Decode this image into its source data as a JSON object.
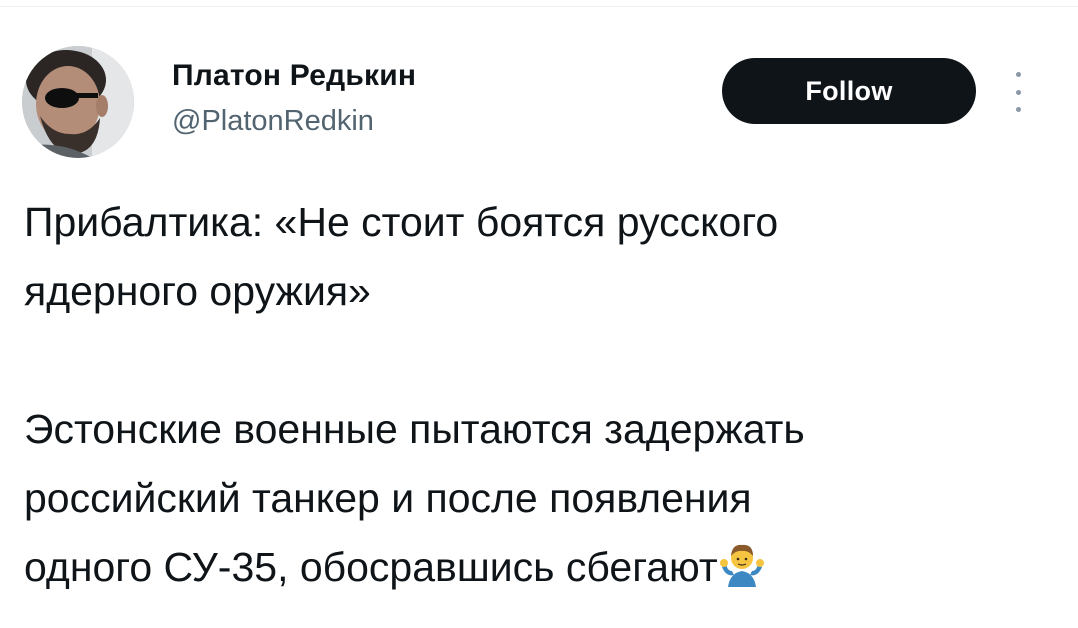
{
  "author": {
    "name": "Платон Редькин",
    "handle": "@PlatonRedkin",
    "avatar_icon": "user-avatar-photo"
  },
  "actions": {
    "follow_label": "Follow",
    "more_icon": "more-vertical-icon"
  },
  "tweet": {
    "line1": "Прибалтика: «Не стоит боятся русского",
    "line2": "ядерного оружия»",
    "line3": "",
    "line4": "Эстонские военные пытаются задержать",
    "line5": "российский танкер и после появления",
    "line6": "одного СУ-35, обосравшись сбегают",
    "emoji": "shrug-emoji"
  },
  "colors": {
    "text": "#0f1419",
    "secondary": "#536471",
    "button_bg": "#0f1419",
    "button_text": "#ffffff"
  }
}
